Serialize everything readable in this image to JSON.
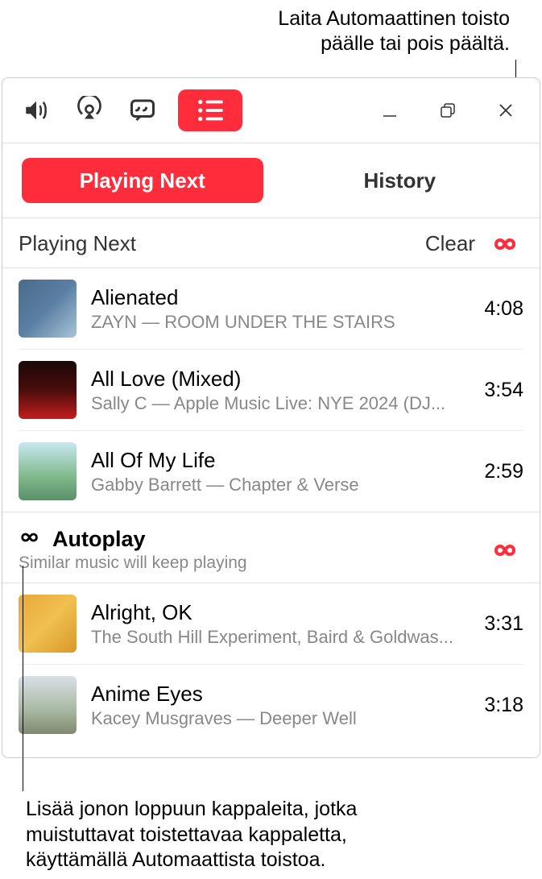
{
  "callouts": {
    "top_line1": "Laita Automaattinen toisto",
    "top_line2": "päälle tai pois päältä.",
    "bottom_line1": "Lisää jonon loppuun kappaleita, jotka",
    "bottom_line2": "muistuttavat toistettavaa kappaletta,",
    "bottom_line3": "käyttämällä Automaattista toistoa."
  },
  "tabs": {
    "playing_next": "Playing Next",
    "history": "History"
  },
  "queue_header": {
    "title": "Playing Next",
    "clear": "Clear"
  },
  "tracks": [
    {
      "title": "Alienated",
      "subtitle": "ZAYN — ROOM UNDER THE STAIRS",
      "duration": "4:08"
    },
    {
      "title": "All Love (Mixed)",
      "subtitle": "Sally C — Apple Music Live: NYE 2024 (DJ...",
      "duration": "3:54"
    },
    {
      "title": "All Of My Life",
      "subtitle": "Gabby Barrett — Chapter & Verse",
      "duration": "2:59"
    }
  ],
  "autoplay": {
    "title": "Autoplay",
    "subtitle": "Similar music will keep playing"
  },
  "autoplay_tracks": [
    {
      "title": "Alright, OK",
      "subtitle": "The South Hill Experiment, Baird & Goldwas...",
      "duration": "3:31"
    },
    {
      "title": "Anime Eyes",
      "subtitle": "Kacey Musgraves — Deeper Well",
      "duration": "3:18"
    }
  ]
}
